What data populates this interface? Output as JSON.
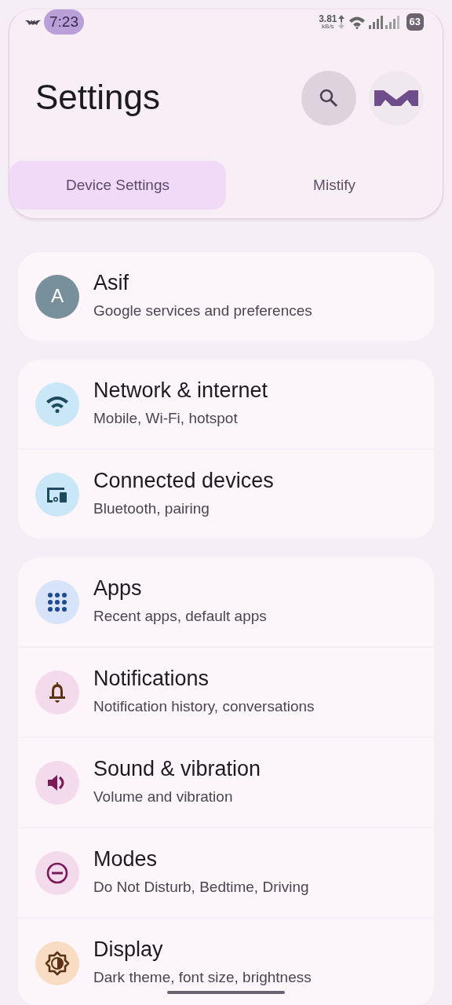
{
  "status_bar": {
    "time": "7:23",
    "net_speed": "3.81",
    "net_unit": "kB/s",
    "battery": "63"
  },
  "title": "Settings",
  "tabs": [
    {
      "label": "Device Settings",
      "selected": true
    },
    {
      "label": "Mistify",
      "selected": false
    }
  ],
  "groups": [
    [
      {
        "kind": "avatar",
        "letter": "A",
        "title": "Asif",
        "subtitle": "Google services and preferences",
        "color": "#78909c"
      }
    ],
    [
      {
        "kind": "wifi",
        "title": "Network & internet",
        "subtitle": "Mobile, Wi-Fi, hotspot",
        "color": "#c9e7f7"
      },
      {
        "kind": "devices",
        "title": "Connected devices",
        "subtitle": "Bluetooth, pairing",
        "color": "#c9e7f7"
      }
    ],
    [
      {
        "kind": "apps",
        "title": "Apps",
        "subtitle": "Recent apps, default apps",
        "color": "#d7e3f8"
      },
      {
        "kind": "bell",
        "title": "Notifications",
        "subtitle": "Notification history, conversations",
        "color": "#f4dbec"
      },
      {
        "kind": "sound",
        "title": "Sound & vibration",
        "subtitle": "Volume and vibration",
        "color": "#f4dbec"
      },
      {
        "kind": "modes",
        "title": "Modes",
        "subtitle": "Do Not Disturb, Bedtime, Driving",
        "color": "#f4dbec"
      },
      {
        "kind": "display",
        "title": "Display",
        "subtitle": "Dark theme, font size, brightness",
        "color": "#f8dcc4"
      }
    ]
  ]
}
